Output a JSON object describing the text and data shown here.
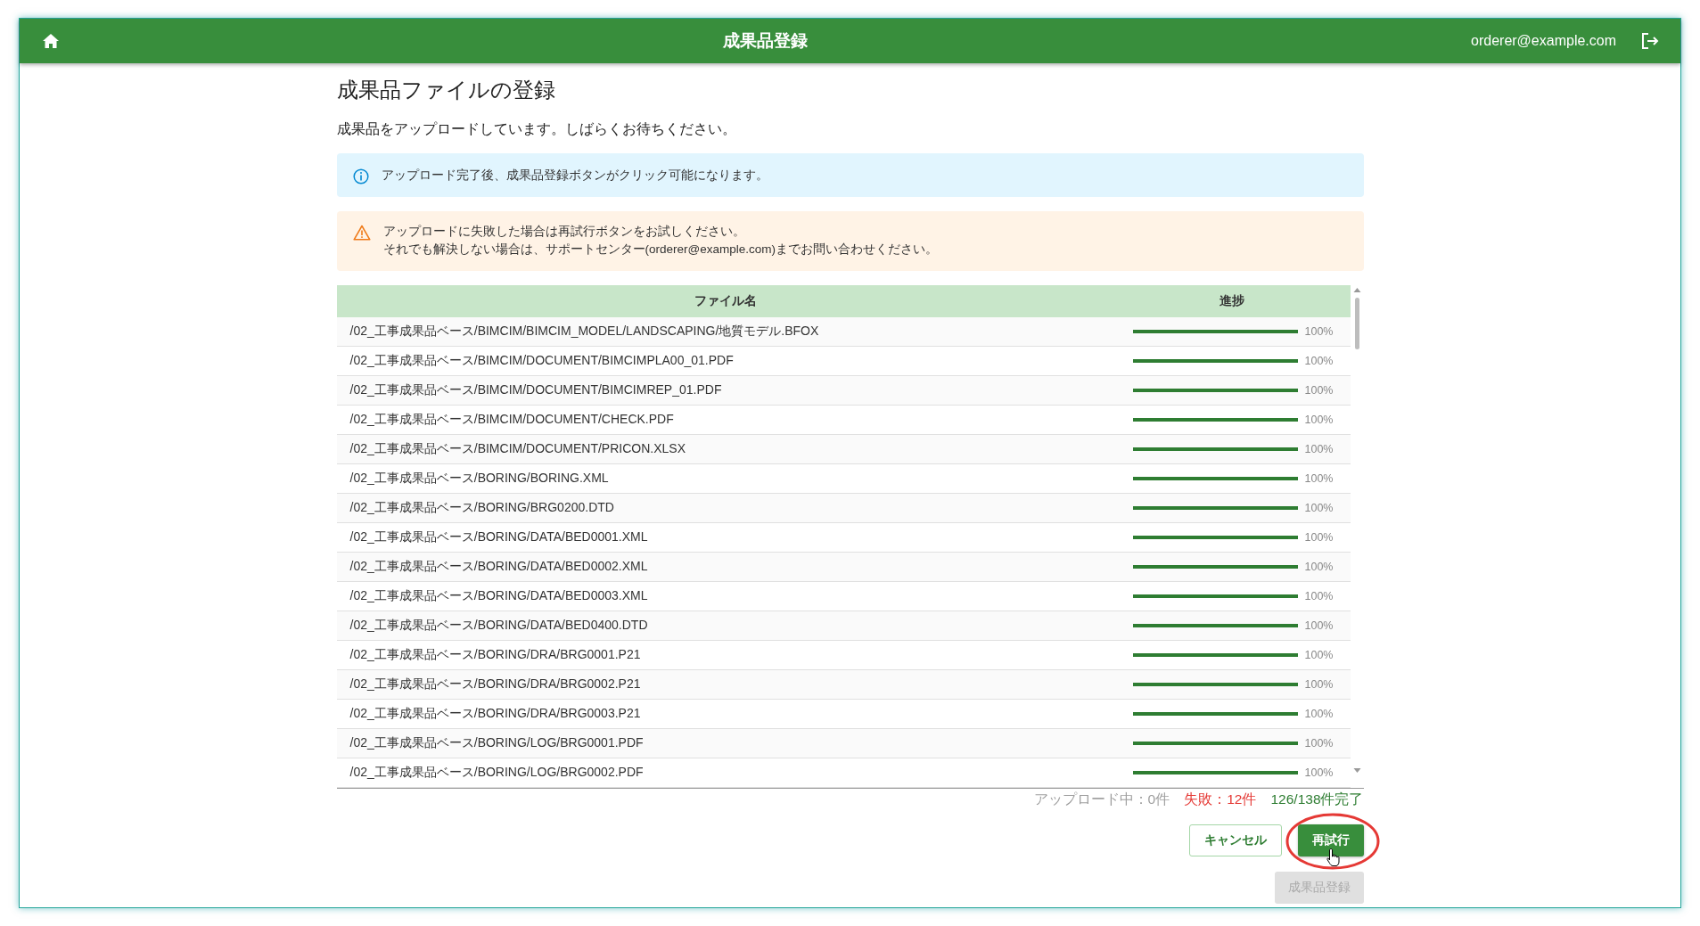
{
  "header": {
    "title": "成果品登録",
    "user": "orderer@example.com"
  },
  "page": {
    "heading": "成果品ファイルの登録",
    "message": "成果品をアップロードしています。しばらくお待ちください。"
  },
  "notices": [
    {
      "kind": "info",
      "lines": [
        "アップロード完了後、成果品登録ボタンがクリック可能になります。"
      ]
    },
    {
      "kind": "warning",
      "lines": [
        "アップロードに失敗した場合は再試行ボタンをお試しください。",
        "それでも解決しない場合は、サポートセンター(orderer@example.com)までお問い合わせください。"
      ]
    }
  ],
  "table": {
    "columns": [
      "ファイル名",
      "進捗"
    ],
    "rows": [
      {
        "file": "/02_工事成果品ベース/BIMCIM/BIMCIM_MODEL/LANDSCAPING/地質モデル.BFOX",
        "level": 1,
        "reading": "100%"
      },
      {
        "file": "/02_工事成果品ベース/BIMCIM/DOCUMENT/BIMCIMPLA00_01.PDF",
        "level": 1,
        "reading": "100%"
      },
      {
        "file": "/02_工事成果品ベース/BIMCIM/DOCUMENT/BIMCIMREP_01.PDF",
        "level": 1,
        "reading": "100%"
      },
      {
        "file": "/02_工事成果品ベース/BIMCIM/DOCUMENT/CHECK.PDF",
        "level": 1,
        "reading": "100%"
      },
      {
        "file": "/02_工事成果品ベース/BIMCIM/DOCUMENT/PRICON.XLSX",
        "level": 1,
        "reading": "100%"
      },
      {
        "file": "/02_工事成果品ベース/BORING/BORING.XML",
        "level": 1,
        "reading": "100%"
      },
      {
        "file": "/02_工事成果品ベース/BORING/BRG0200.DTD",
        "level": 1,
        "reading": "100%"
      },
      {
        "file": "/02_工事成果品ベース/BORING/DATA/BED0001.XML",
        "level": 1,
        "reading": "100%"
      },
      {
        "file": "/02_工事成果品ベース/BORING/DATA/BED0002.XML",
        "level": 1,
        "reading": "100%"
      },
      {
        "file": "/02_工事成果品ベース/BORING/DATA/BED0003.XML",
        "level": 1,
        "reading": "100%"
      },
      {
        "file": "/02_工事成果品ベース/BORING/DATA/BED0400.DTD",
        "level": 1,
        "reading": "100%"
      },
      {
        "file": "/02_工事成果品ベース/BORING/DRA/BRG0001.P21",
        "level": 1,
        "reading": "100%"
      },
      {
        "file": "/02_工事成果品ベース/BORING/DRA/BRG0002.P21",
        "level": 1,
        "reading": "100%"
      },
      {
        "file": "/02_工事成果品ベース/BORING/DRA/BRG0003.P21",
        "level": 1,
        "reading": "100%"
      },
      {
        "file": "/02_工事成果品ベース/BORING/LOG/BRG0001.PDF",
        "level": 1,
        "reading": "100%"
      },
      {
        "file": "/02_工事成果品ベース/BORING/LOG/BRG0002.PDF",
        "level": 1,
        "reading": "100%"
      }
    ]
  },
  "status": [
    {
      "kind": "uploading",
      "text": "アップロード中：0件"
    },
    {
      "kind": "failed",
      "text": "失敗：12件"
    },
    {
      "kind": "done",
      "text": "126/138件完了"
    }
  ],
  "actions": [
    {
      "kind": "outlined",
      "label": "キャンセル",
      "annotated": false
    },
    {
      "kind": "primary",
      "label": "再試行",
      "annotated": true
    }
  ],
  "submit": {
    "label": "成果品登録",
    "disabled": true
  }
}
